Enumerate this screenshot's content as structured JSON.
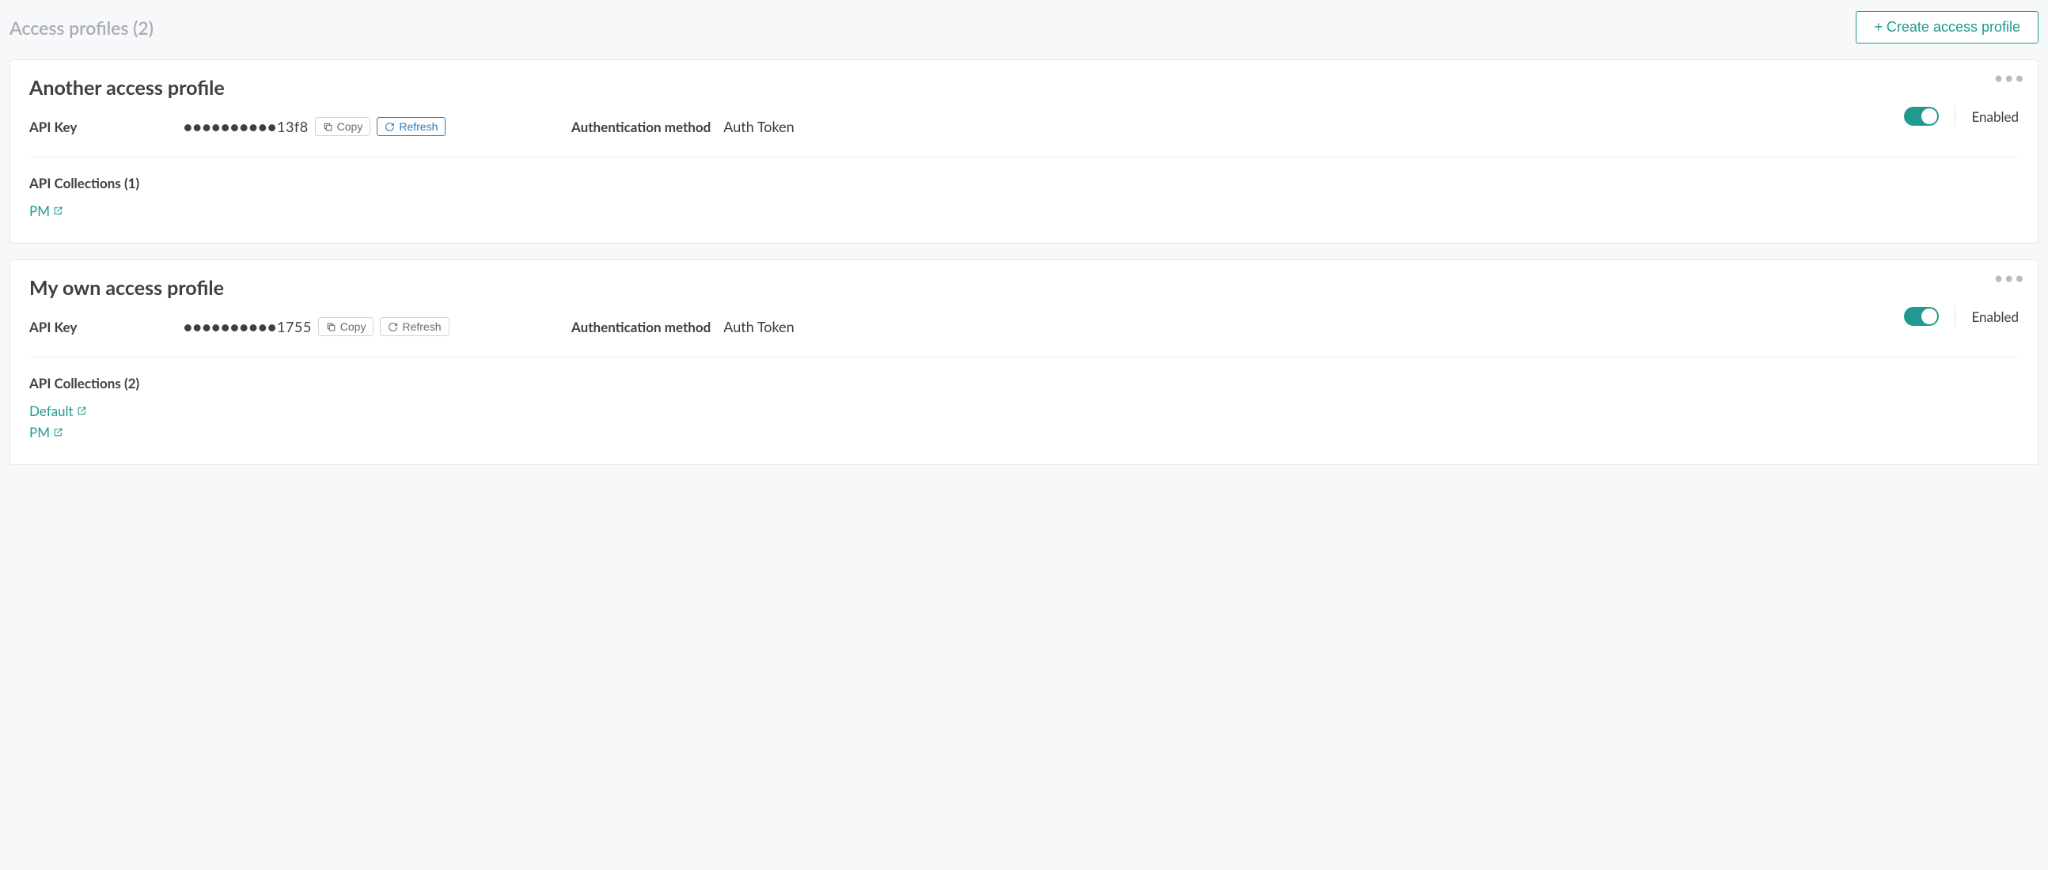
{
  "header": {
    "title": "Access profiles (2)",
    "create_button": "+ Create access profile"
  },
  "labels": {
    "api_key": "API Key",
    "auth_method": "Authentication method",
    "copy": "Copy",
    "refresh": "Refresh",
    "enabled": "Enabled"
  },
  "profiles": [
    {
      "title": "Another access profile",
      "api_key_mask": "●●●●●●●●●●",
      "api_key_suffix": "13f8",
      "auth_value": "Auth Token",
      "refresh_active": true,
      "collections_header": "API Collections (1)",
      "collections": [
        "PM"
      ]
    },
    {
      "title": "My own access profile",
      "api_key_mask": "●●●●●●●●●●",
      "api_key_suffix": "1755",
      "auth_value": "Auth Token",
      "refresh_active": false,
      "collections_header": "API Collections (2)",
      "collections": [
        "Default",
        "PM"
      ]
    }
  ]
}
